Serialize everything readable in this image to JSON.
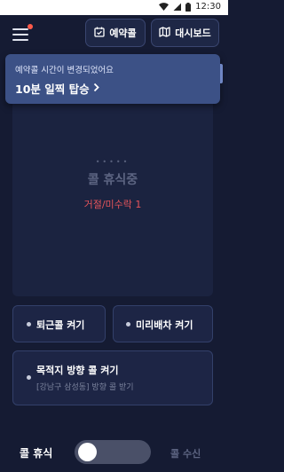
{
  "status_bar": {
    "time": "12:30",
    "icons": [
      "wifi-icon",
      "signal-icon",
      "battery-icon"
    ]
  },
  "header": {
    "menu_icon": "hamburger-menu-icon",
    "notification_dot_color": "#ff5a4a",
    "reserve_button": {
      "label": "예약콜",
      "icon": "calendar-check-icon"
    },
    "dashboard_button": {
      "label": "대시보드",
      "icon": "map-icon"
    }
  },
  "toast": {
    "message": "예약콜 시간이 변경되었어요",
    "detail": "10분 일찍 탑승",
    "chevron_icon": "chevron-right-icon",
    "background_color": "#3c5186"
  },
  "status_card": {
    "indicator": "•••••",
    "status_text": "콜 휴식중",
    "reject_text": "거절/미수락 1",
    "reject_color": "#e8555b"
  },
  "options": {
    "commute_call": {
      "label": "퇴근콜 켜기"
    },
    "pre_dispatch": {
      "label": "미리배차 켜기"
    },
    "destination_call": {
      "label": "목적지 방향 콜 켜기",
      "sub_label": "[강남구 삼성동] 방향 콜 받기"
    }
  },
  "bottom_toggle": {
    "left_label": "콜 휴식",
    "right_label": "콜 수신",
    "is_receiving": false
  },
  "colors": {
    "background": "#151b33",
    "card": "#1b2340",
    "button": "#1d2545",
    "accent_red": "#e8555b"
  }
}
